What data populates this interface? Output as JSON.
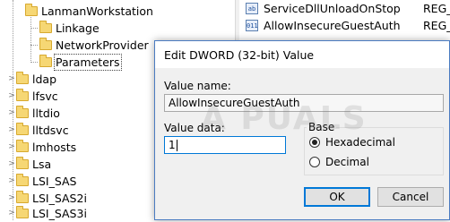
{
  "tree": {
    "items": [
      {
        "label": "LanmanWorkstation",
        "expander": ""
      },
      {
        "label": "Linkage",
        "expander": ""
      },
      {
        "label": "NetworkProvider",
        "expander": ""
      },
      {
        "label": "Parameters",
        "expander": ""
      },
      {
        "label": "ldap",
        "expander": ">"
      },
      {
        "label": "lfsvc",
        "expander": ">"
      },
      {
        "label": "lltdio",
        "expander": ">"
      },
      {
        "label": "lltdsvc",
        "expander": ">"
      },
      {
        "label": "lmhosts",
        "expander": ">"
      },
      {
        "label": "Lsa",
        "expander": ">"
      },
      {
        "label": "LSI_SAS",
        "expander": ">"
      },
      {
        "label": "LSI_SAS2i",
        "expander": ">"
      },
      {
        "label": "LSI_SAS3i",
        "expander": ">"
      }
    ]
  },
  "values": {
    "rows": [
      {
        "name": "ServiceDllUnloadOnStop",
        "type": "REG_D",
        "icon": "ab"
      },
      {
        "name": "AllowInsecureGuestAuth",
        "type": "REG_D",
        "icon": "011"
      }
    ]
  },
  "dialog": {
    "title": "Edit DWORD (32-bit) Value",
    "value_name_label": "Value name:",
    "value_name": "AllowInsecureGuestAuth",
    "value_data_label": "Value data:",
    "value_data": "1",
    "base_label": "Base",
    "radio_hex": "Hexadecimal",
    "radio_dec": "Decimal",
    "ok_label": "OK",
    "cancel_label": "Cancel",
    "selected_base": "Hexadecimal"
  },
  "watermark": "A PUALS",
  "colors": {
    "accent": "#0078d7",
    "folder": "#f6d774",
    "dialog_border": "#4a7bc1"
  }
}
